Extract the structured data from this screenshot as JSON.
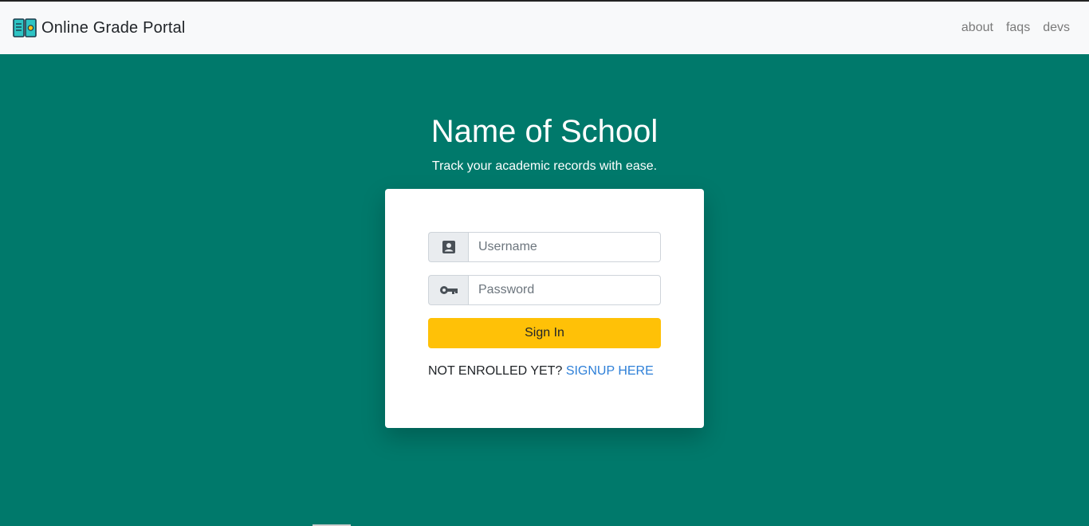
{
  "navbar": {
    "brand_icon": "book-icon",
    "brand_text": "Online Grade Portal",
    "links": [
      {
        "label": "about"
      },
      {
        "label": "faqs"
      },
      {
        "label": "devs"
      }
    ]
  },
  "hero": {
    "title": "Name of School",
    "subtitle": "Track your academic records with ease."
  },
  "login": {
    "username": {
      "placeholder": "Username",
      "value": "",
      "icon": "id-card-icon"
    },
    "password": {
      "placeholder": "Password",
      "value": "",
      "icon": "key-icon"
    },
    "signin_label": "Sign In",
    "signup_prompt": "NOT ENROLLED YET?",
    "signup_link": "SIGNUP HERE"
  },
  "colors": {
    "background": "#00796b",
    "navbar": "#f8f9fa",
    "button": "#ffc107",
    "link": "#2f80d8"
  }
}
